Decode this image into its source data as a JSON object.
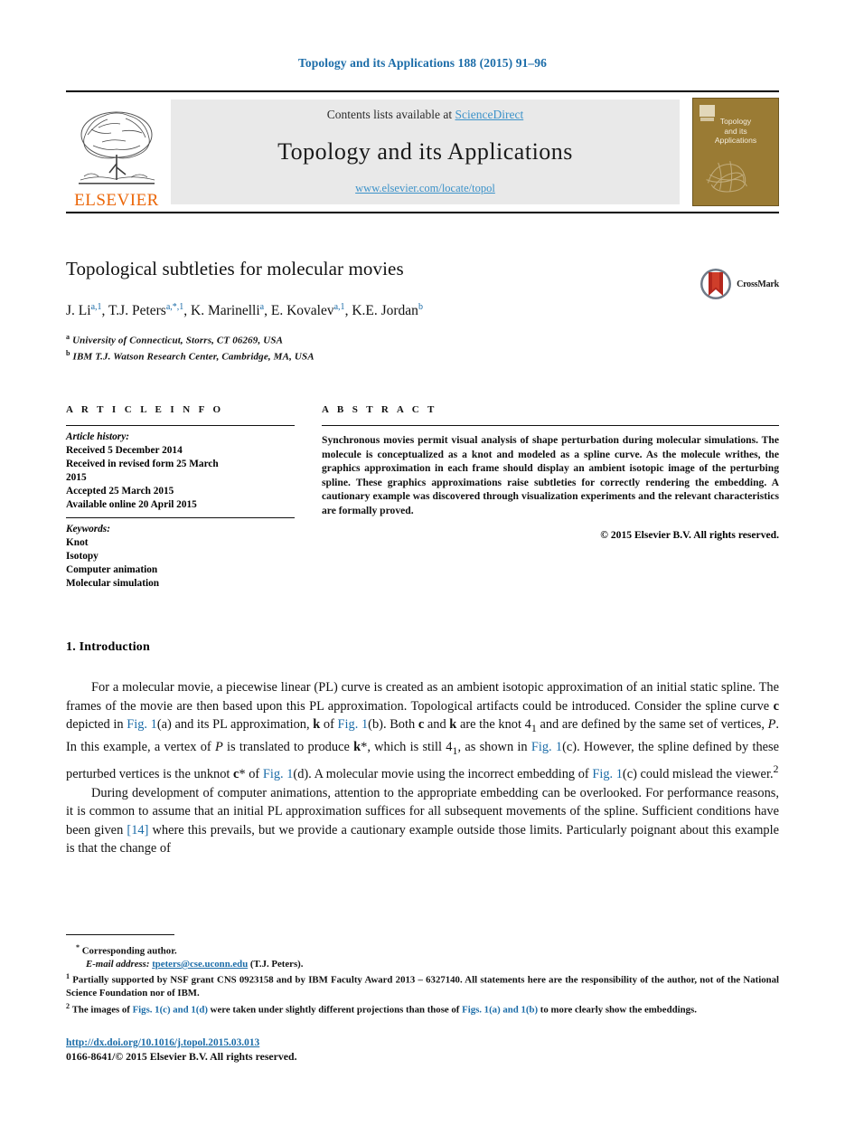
{
  "running_head": "Topology and its Applications 188 (2015) 91–96",
  "masthead": {
    "contents_prefix": "Contents lists available at ",
    "sciencedirect": "ScienceDirect",
    "journal_title": "Topology and its Applications",
    "journal_url": "www.elsevier.com/locate/topol",
    "publisher_wordmark": "ELSEVIER",
    "cover_title_line1": "Topology",
    "cover_title_line2": "and its",
    "cover_title_line3": "Applications",
    "cover_color": "#9a7b34",
    "link_color": "#3c92c9"
  },
  "article": {
    "title": "Topological subtleties for molecular movies",
    "authors_html": "J. Li<sup>a,1</sup>, T.J. Peters<sup>a,*,1</sup>, K. Marinelli<sup>a</sup>, E. Kovalev<sup>a,1</sup>, K.E. Jordan<sup>b</sup>",
    "affiliations": [
      {
        "marker": "a",
        "text": "University of Connecticut, Storrs, CT 06269, USA"
      },
      {
        "marker": "b",
        "text": "IBM T.J. Watson Research Center, Cambridge, MA, USA"
      }
    ],
    "crossmark_label": "CrossMark"
  },
  "info": {
    "section_label": "A R T I C L E   I N F O",
    "history_head": "Article history:",
    "history_lines": [
      "Received 5 December 2014",
      "Received in revised form 25 March",
      "2015",
      "Accepted 25 March 2015",
      "Available online 20 April 2015"
    ],
    "keywords_head": "Keywords:",
    "keywords": [
      "Knot",
      "Isotopy",
      "Computer animation",
      "Molecular simulation"
    ]
  },
  "abstract": {
    "section_label": "A B S T R A C T",
    "text": "Synchronous movies permit visual analysis of shape perturbation during molecular simulations. The molecule is conceptualized as a knot and modeled as a spline curve. As the molecule writhes, the graphics approximation in each frame should display an ambient isotopic image of the perturbing spline. These graphics approximations raise subtleties for correctly rendering the embedding. A cautionary example was discovered through visualization experiments and the relevant characteristics are formally proved.",
    "copyright": "© 2015 Elsevier B.V. All rights reserved."
  },
  "body": {
    "section_heading": "1. Introduction",
    "paragraph1_html": "For a molecular movie, a piecewise linear (PL) curve is created as an ambient isotopic approximation of an initial static spline. The frames of the movie are then based upon this PL approximation. Topological artifacts could be introduced. Consider the spline curve <b>c</b> depicted in <span class=\"lnk\">Fig. 1</span>(a) and its PL approximation, <b>k</b> of <span class=\"lnk\">Fig. 1</span>(b). Both <b>c</b> and <b>k</b> are the knot 4<sub>1</sub> and are defined by the same set of vertices, <i>P</i>. In this example, a vertex of <i>P</i> is translated to produce <b>k</b>*, which is still 4<sub>1</sub>, as shown in <span class=\"lnk\">Fig. 1</span>(c). However, the spline defined by these perturbed vertices is the unknot <b>c</b>* of <span class=\"lnk\">Fig. 1</span>(d). A molecular movie using the incorrect embedding of <span class=\"lnk\">Fig. 1</span>(c) could mislead the viewer.<sup>2</sup>",
    "paragraph2_html": "During development of computer animations, attention to the appropriate embedding can be overlooked. For performance reasons, it is common to assume that an initial PL approximation suffices for all subsequent movements of the spline. Sufficient conditions have been given <span class=\"lnk\">[14]</span> where this prevails, but we provide a cautionary example outside those limits. Particularly poignant about this example is that the change of"
  },
  "footnotes": {
    "corresponding": "Corresponding author.",
    "email_label": "E-mail address:",
    "email": "tpeters@cse.uconn.edu",
    "email_suffix": "(T.J. Peters).",
    "note1": "Partially supported by NSF grant CNS 0923158 and by IBM Faculty Award 2013 – 6327140. All statements here are the responsibility of the author, not of the National Science Foundation nor of IBM.",
    "note2_html": "The images of <span class=\"lnk\">Figs. 1(c) and 1(d)</span> were taken under slightly different projections than those of <span class=\"lnk\">Figs. 1(a) and 1(b)</span> to more clearly show the embeddings."
  },
  "footer": {
    "doi": "http://dx.doi.org/10.1016/j.topol.2015.03.013",
    "issn_line": "0166-8641/© 2015 Elsevier B.V. All rights reserved."
  }
}
